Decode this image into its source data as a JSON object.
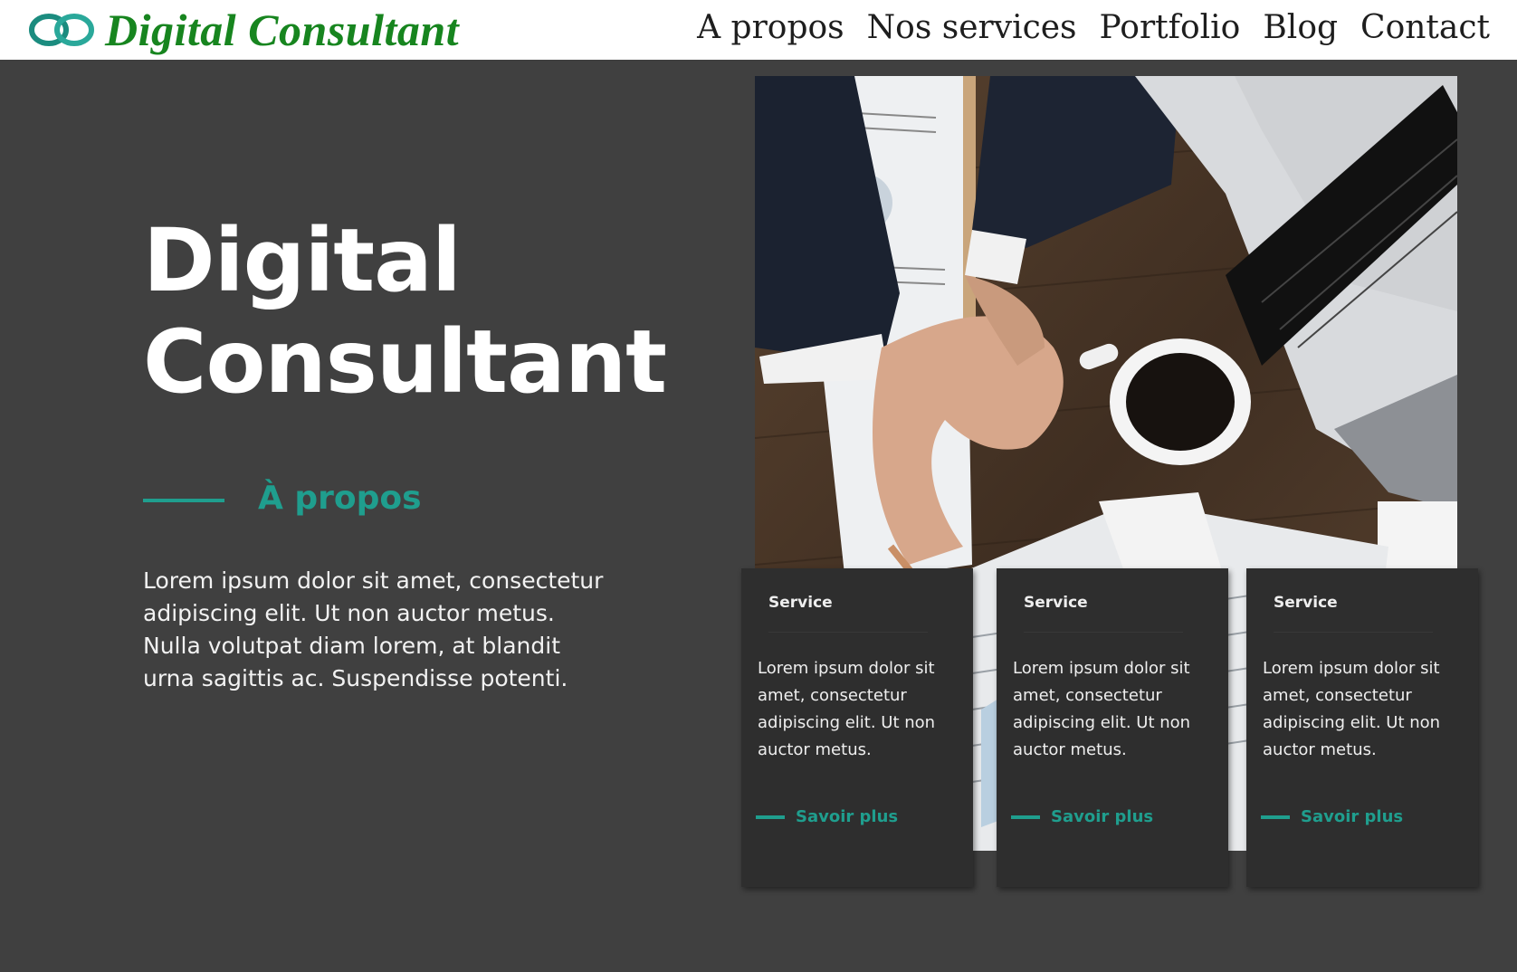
{
  "brand": {
    "name": "Digital Consultant",
    "logo_icon": "interlocking-rings-logo"
  },
  "nav": {
    "items": [
      "A propos",
      "Nos services",
      "Portfolio",
      "Blog",
      "Contact"
    ]
  },
  "hero": {
    "title_line1": "Digital",
    "title_line2": "Consultant"
  },
  "about": {
    "heading": "À propos",
    "text": "Lorem ipsum dolor sit amet, consectetur adipiscing elit. Ut non auctor metus. Nulla volutpat diam lorem, at blandit urna sagittis ac. Suspendisse potenti."
  },
  "services": [
    {
      "title": "Service",
      "body": "Lorem ipsum dolor sit amet, consectetur adipiscing elit. Ut non auctor metus.",
      "cta": "Savoir plus"
    },
    {
      "title": "Service",
      "body": "Lorem ipsum dolor sit amet, consectetur adipiscing elit. Ut non auctor metus.",
      "cta": "Savoir plus"
    },
    {
      "title": "Service",
      "body": "Lorem ipsum dolor sit amet, consectetur adipiscing elit. Ut non auctor metus.",
      "cta": "Savoir plus"
    }
  ],
  "colors": {
    "accent": "#1f9e8e",
    "background": "#404040",
    "card": "#2e2e2e",
    "logo_text": "#17851f"
  }
}
